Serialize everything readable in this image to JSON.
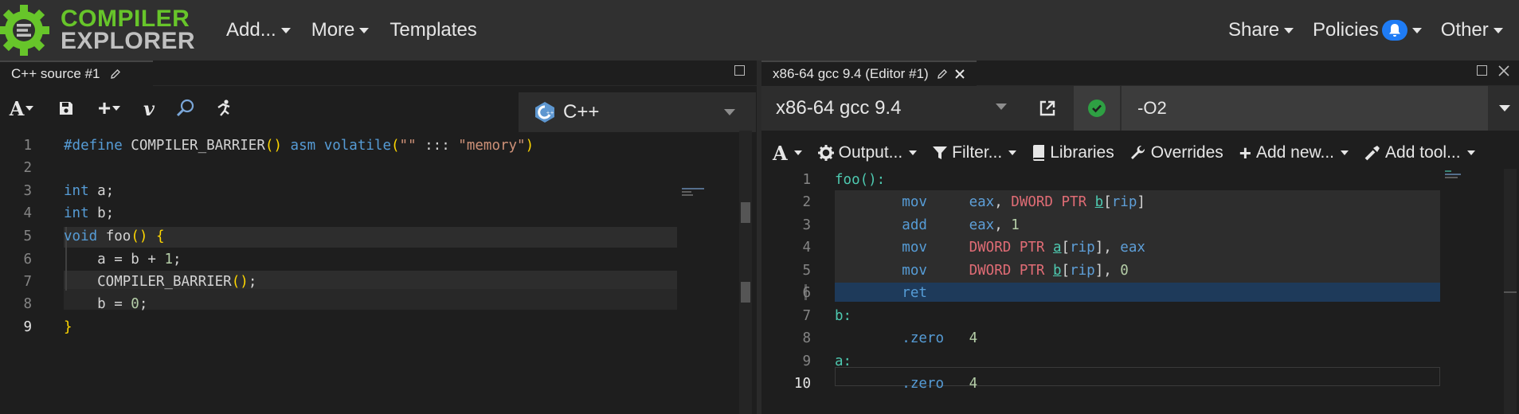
{
  "header": {
    "logo_line1": "COMPILER",
    "logo_line2": "EXPLORER",
    "menu_add": "Add...",
    "menu_more": "More",
    "menu_templates": "Templates",
    "menu_share": "Share",
    "menu_policies": "Policies",
    "menu_other": "Other"
  },
  "source_pane": {
    "tab_title": "C++ source #1",
    "language": "C++",
    "line_numbers": [
      "1",
      "2",
      "3",
      "4",
      "5",
      "6",
      "7",
      "8",
      "9"
    ],
    "lines": [
      "#define COMPILER_BARRIER() asm volatile(\"\" ::: \"memory\")",
      "",
      "int a;",
      "int b;",
      "void foo() {",
      "    a = b + 1;",
      "    COMPILER_BARRIER();",
      "    b = 0;",
      "}"
    ]
  },
  "compiler_pane": {
    "tab_title": "x86-64 gcc 9.4 (Editor #1)",
    "compiler_name": "x86-64 gcc 9.4",
    "options": "-O2",
    "buttons": {
      "output": "Output...",
      "filter": "Filter...",
      "libraries": "Libraries",
      "overrides": "Overrides",
      "add_new": "Add new...",
      "add_tool": "Add tool..."
    },
    "line_numbers": [
      "1",
      "2",
      "3",
      "4",
      "5",
      "6",
      "7",
      "8",
      "9",
      "10"
    ],
    "lines": [
      "foo():",
      "        mov     eax, DWORD PTR b[rip]",
      "        add     eax, 1",
      "        mov     DWORD PTR a[rip], eax",
      "        mov     DWORD PTR b[rip], 0",
      "        ret",
      "b:",
      "        .zero   4",
      "a:",
      "        .zero   4"
    ]
  },
  "colors": {
    "brand_green": "#67c52a",
    "notification_blue": "#1f7cf5",
    "status_ok": "#2ea043"
  }
}
